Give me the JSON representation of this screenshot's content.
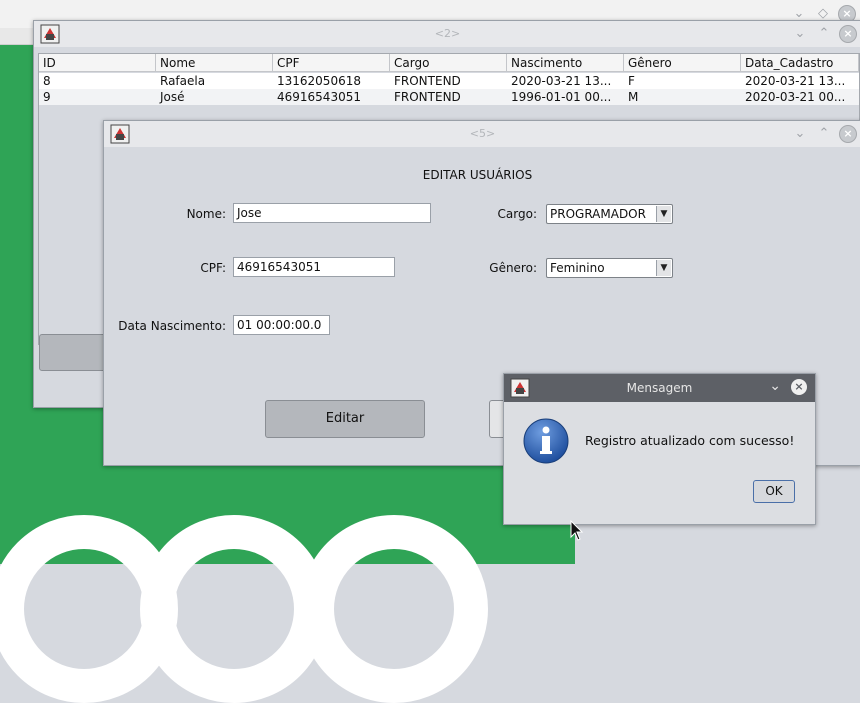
{
  "background": {
    "accent_green": "#2fa456"
  },
  "window_users": {
    "title": "<2>",
    "columns": [
      "ID",
      "Nome",
      "CPF",
      "Cargo",
      "Nascimento",
      "Gênero",
      "Data_Cadastro"
    ],
    "rows": [
      [
        "8",
        "Rafaela",
        "13162050618",
        "FRONTEND",
        "2020-03-21 13...",
        "F",
        "2020-03-21 13..."
      ],
      [
        "9",
        "José",
        "46916543051",
        "FRONTEND",
        "1996-01-01 00...",
        "M",
        "2020-03-21 00..."
      ]
    ]
  },
  "window_edit": {
    "title": "<5>",
    "heading": "EDITAR USUÁRIOS",
    "nome_label": "Nome:",
    "nome_value": "Jose",
    "cpf_label": "CPF:",
    "cpf_value": "46916543051",
    "nascimento_label": "Data Nascimento:",
    "nascimento_value": "01 00:00:00.0",
    "cargo_label": "Cargo:",
    "cargo_value": "PROGRAMADOR",
    "genero_label": "Gênero:",
    "genero_value": "Feminino",
    "edit_button": "Editar"
  },
  "dialog": {
    "title": "Mensagem",
    "message": "Registro atualizado com sucesso!",
    "ok_button": "OK",
    "info_icon_color": "#2d62b4"
  }
}
